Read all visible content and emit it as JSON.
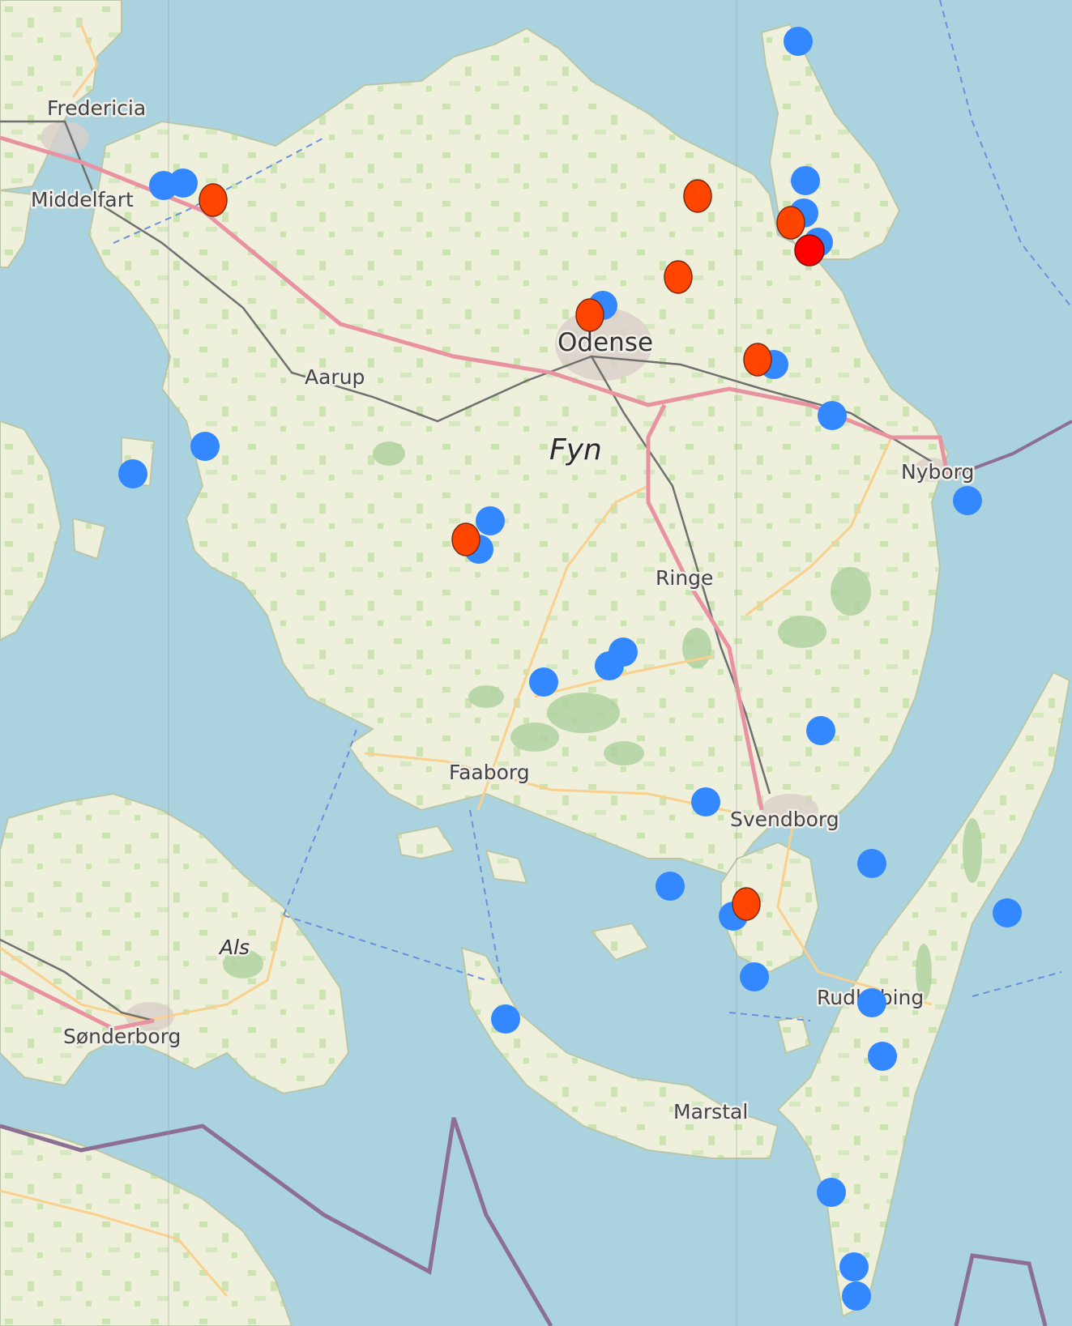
{
  "map": {
    "labels": {
      "fredericia": "Fredericia",
      "middelfart": "Middelfart",
      "odense": "Odense",
      "aarup": "Aarup",
      "fyn": "Fyn",
      "nyborg": "Nyborg",
      "ringe": "Ringe",
      "faaborg": "Faaborg",
      "svendborg": "Svendborg",
      "als": "Als",
      "sonderborg": "Sønderborg",
      "rudkobing": "Rudkøbing",
      "marstal": "Marstal"
    },
    "colors": {
      "water": "#aad3df",
      "land": "#f2efe9",
      "forest": "#add19e",
      "motorway": "#e892a2",
      "secondary_road": "#f9d08d",
      "railway": "#707070",
      "border": "#8d6f94",
      "marker_blue": "#3388ff",
      "marker_orange": "#ff4500",
      "marker_red": "#ff0000"
    },
    "marker_legend": [
      "blue",
      "orange",
      "red"
    ]
  }
}
